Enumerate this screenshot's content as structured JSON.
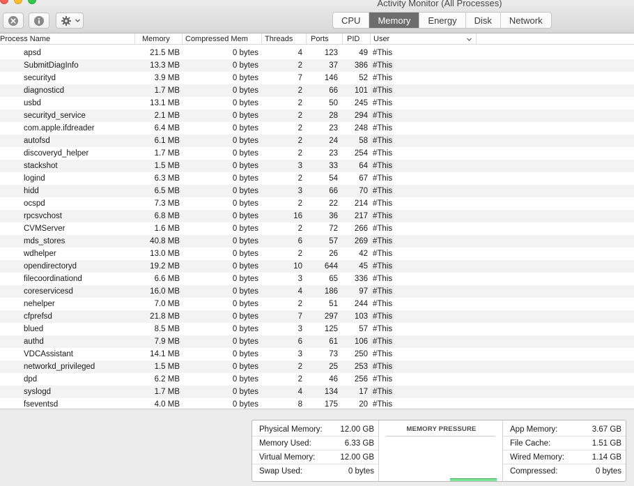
{
  "window": {
    "title": "Activity Monitor (All Processes)"
  },
  "toolbar": {
    "buttons": [
      {
        "name": "quit-process",
        "icon": "close-circle-icon"
      },
      {
        "name": "inspect-process",
        "icon": "info-icon"
      },
      {
        "name": "actions-menu",
        "icon": "gear-icon"
      }
    ],
    "tabs": [
      {
        "label": "CPU",
        "active": false
      },
      {
        "label": "Memory",
        "active": true
      },
      {
        "label": "Energy",
        "active": false
      },
      {
        "label": "Disk",
        "active": false
      },
      {
        "label": "Network",
        "active": false
      }
    ]
  },
  "table": {
    "columns": {
      "process_name": "Process Name",
      "memory": "Memory",
      "compressed": "Compressed Mem",
      "threads": "Threads",
      "ports": "Ports",
      "pid": "PID",
      "user": "User"
    },
    "rows": [
      {
        "name": "apsd",
        "memory": "21.5 MB",
        "compressed": "0 bytes",
        "threads": "4",
        "ports": "123",
        "pid": "49",
        "user": "#This"
      },
      {
        "name": "SubmitDiagInfo",
        "memory": "13.3 MB",
        "compressed": "0 bytes",
        "threads": "2",
        "ports": "37",
        "pid": "386",
        "user": "#This"
      },
      {
        "name": "securityd",
        "memory": "3.9 MB",
        "compressed": "0 bytes",
        "threads": "7",
        "ports": "146",
        "pid": "52",
        "user": "#This"
      },
      {
        "name": "diagnosticd",
        "memory": "1.7 MB",
        "compressed": "0 bytes",
        "threads": "2",
        "ports": "66",
        "pid": "101",
        "user": "#This"
      },
      {
        "name": "usbd",
        "memory": "13.1 MB",
        "compressed": "0 bytes",
        "threads": "2",
        "ports": "50",
        "pid": "245",
        "user": "#This"
      },
      {
        "name": "securityd_service",
        "memory": "2.1 MB",
        "compressed": "0 bytes",
        "threads": "2",
        "ports": "28",
        "pid": "294",
        "user": "#This"
      },
      {
        "name": "com.apple.ifdreader",
        "memory": "6.4 MB",
        "compressed": "0 bytes",
        "threads": "2",
        "ports": "23",
        "pid": "248",
        "user": "#This"
      },
      {
        "name": "autofsd",
        "memory": "6.1 MB",
        "compressed": "0 bytes",
        "threads": "2",
        "ports": "24",
        "pid": "58",
        "user": "#This"
      },
      {
        "name": "discoveryd_helper",
        "memory": "1.7 MB",
        "compressed": "0 bytes",
        "threads": "2",
        "ports": "23",
        "pid": "254",
        "user": "#This"
      },
      {
        "name": "stackshot",
        "memory": "1.5 MB",
        "compressed": "0 bytes",
        "threads": "3",
        "ports": "33",
        "pid": "64",
        "user": "#This"
      },
      {
        "name": "logind",
        "memory": "6.3 MB",
        "compressed": "0 bytes",
        "threads": "2",
        "ports": "54",
        "pid": "67",
        "user": "#This"
      },
      {
        "name": "hidd",
        "memory": "6.5 MB",
        "compressed": "0 bytes",
        "threads": "3",
        "ports": "66",
        "pid": "70",
        "user": "#This"
      },
      {
        "name": "ocspd",
        "memory": "7.3 MB",
        "compressed": "0 bytes",
        "threads": "2",
        "ports": "22",
        "pid": "214",
        "user": "#This"
      },
      {
        "name": "rpcsvchost",
        "memory": "6.8 MB",
        "compressed": "0 bytes",
        "threads": "16",
        "ports": "36",
        "pid": "217",
        "user": "#This"
      },
      {
        "name": "CVMServer",
        "memory": "1.6 MB",
        "compressed": "0 bytes",
        "threads": "2",
        "ports": "72",
        "pid": "266",
        "user": "#This"
      },
      {
        "name": "mds_stores",
        "memory": "40.8 MB",
        "compressed": "0 bytes",
        "threads": "6",
        "ports": "57",
        "pid": "269",
        "user": "#This"
      },
      {
        "name": "wdhelper",
        "memory": "13.0 MB",
        "compressed": "0 bytes",
        "threads": "2",
        "ports": "26",
        "pid": "42",
        "user": "#This"
      },
      {
        "name": "opendirectoryd",
        "memory": "19.2 MB",
        "compressed": "0 bytes",
        "threads": "10",
        "ports": "644",
        "pid": "45",
        "user": "#This"
      },
      {
        "name": "filecoordinationd",
        "memory": "6.6 MB",
        "compressed": "0 bytes",
        "threads": "3",
        "ports": "65",
        "pid": "336",
        "user": "#This"
      },
      {
        "name": "coreservicesd",
        "memory": "16.0 MB",
        "compressed": "0 bytes",
        "threads": "4",
        "ports": "186",
        "pid": "97",
        "user": "#This"
      },
      {
        "name": "nehelper",
        "memory": "7.0 MB",
        "compressed": "0 bytes",
        "threads": "2",
        "ports": "51",
        "pid": "244",
        "user": "#This"
      },
      {
        "name": "cfprefsd",
        "memory": "21.8 MB",
        "compressed": "0 bytes",
        "threads": "7",
        "ports": "297",
        "pid": "103",
        "user": "#This"
      },
      {
        "name": "blued",
        "memory": "8.5 MB",
        "compressed": "0 bytes",
        "threads": "3",
        "ports": "125",
        "pid": "57",
        "user": "#This"
      },
      {
        "name": "authd",
        "memory": "7.9 MB",
        "compressed": "0 bytes",
        "threads": "6",
        "ports": "61",
        "pid": "106",
        "user": "#This"
      },
      {
        "name": "VDCAssistant",
        "memory": "14.1 MB",
        "compressed": "0 bytes",
        "threads": "3",
        "ports": "73",
        "pid": "250",
        "user": "#This"
      },
      {
        "name": "networkd_privileged",
        "memory": "1.5 MB",
        "compressed": "0 bytes",
        "threads": "2",
        "ports": "25",
        "pid": "253",
        "user": "#This"
      },
      {
        "name": "dpd",
        "memory": "6.2 MB",
        "compressed": "0 bytes",
        "threads": "2",
        "ports": "46",
        "pid": "256",
        "user": "#This"
      },
      {
        "name": "syslogd",
        "memory": "1.7 MB",
        "compressed": "0 bytes",
        "threads": "4",
        "ports": "134",
        "pid": "17",
        "user": "#This"
      },
      {
        "name": "fseventsd",
        "memory": "4.0 MB",
        "compressed": "0 bytes",
        "threads": "8",
        "ports": "175",
        "pid": "20",
        "user": "#This"
      }
    ]
  },
  "footer": {
    "left_stats": [
      {
        "label": "Physical Memory:",
        "value": "12.00 GB"
      },
      {
        "label": "Memory Used:",
        "value": "6.33 GB"
      },
      {
        "label": "Virtual Memory:",
        "value": "12.00 GB"
      },
      {
        "label": "Swap Used:",
        "value": "0 bytes"
      }
    ],
    "pressure": {
      "title": "MEMORY PRESSURE",
      "level_fraction": 0.07,
      "color": "#7fe39a"
    },
    "right_stats": [
      {
        "label": "App Memory:",
        "value": "3.67 GB"
      },
      {
        "label": "File Cache:",
        "value": "1.51 GB"
      },
      {
        "label": "Wired Memory:",
        "value": "1.14 GB"
      },
      {
        "label": "Compressed:",
        "value": "0 bytes"
      }
    ]
  },
  "colors": {
    "active_tab": "#6d6d6d",
    "close": "#fc5f57",
    "minimize": "#fdbc2e",
    "maximize": "#34c84a"
  }
}
